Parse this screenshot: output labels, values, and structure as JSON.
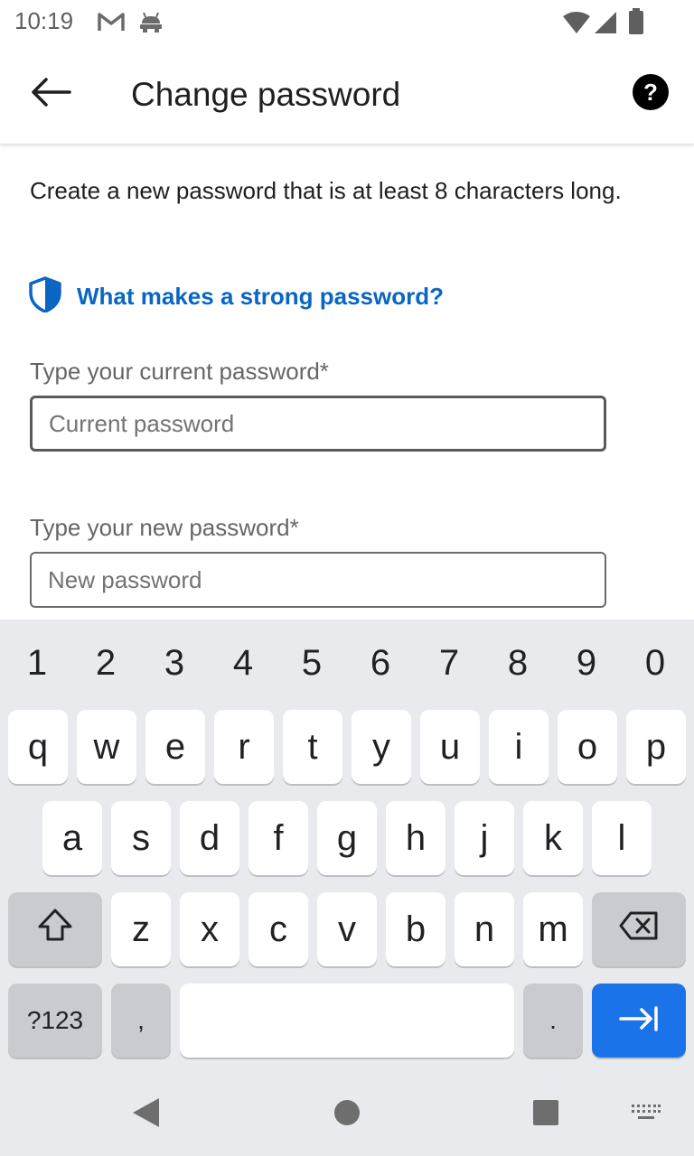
{
  "status_bar": {
    "time": "10:19",
    "icons": [
      "gmail-icon",
      "android-robot-icon",
      "wifi-icon",
      "cell-signal-icon",
      "battery-icon"
    ]
  },
  "app_bar": {
    "title": "Change password",
    "back_icon": "arrow-left-icon",
    "help_icon": "help-circle-icon"
  },
  "content": {
    "intro": "Create a new password that is at least 8 characters long.",
    "strong_link": {
      "icon": "shield-icon",
      "label": "What makes a strong password?",
      "color": "#0a66c2"
    },
    "fields": [
      {
        "label": "Type your current password*",
        "placeholder": "Current password",
        "value": "",
        "focused": true
      },
      {
        "label": "Type your new password*",
        "placeholder": "New password",
        "value": "",
        "focused": false
      }
    ]
  },
  "keyboard": {
    "number_row": [
      "1",
      "2",
      "3",
      "4",
      "5",
      "6",
      "7",
      "8",
      "9",
      "0"
    ],
    "row1": [
      "q",
      "w",
      "e",
      "r",
      "t",
      "y",
      "u",
      "i",
      "o",
      "p"
    ],
    "row2": [
      "a",
      "s",
      "d",
      "f",
      "g",
      "h",
      "j",
      "k",
      "l"
    ],
    "row3": [
      "z",
      "x",
      "c",
      "v",
      "b",
      "n",
      "m"
    ],
    "shift_icon": "shift-arrow-icon",
    "backspace_icon": "backspace-icon",
    "symbols_label": "?123",
    "comma_label": ",",
    "period_label": ".",
    "enter_icon": "tab-next-icon",
    "accent_color": "#1a73e8"
  },
  "nav_bar": {
    "icons": [
      "back-triangle-icon",
      "home-circle-icon",
      "recents-square-icon",
      "keyboard-switch-icon"
    ]
  }
}
